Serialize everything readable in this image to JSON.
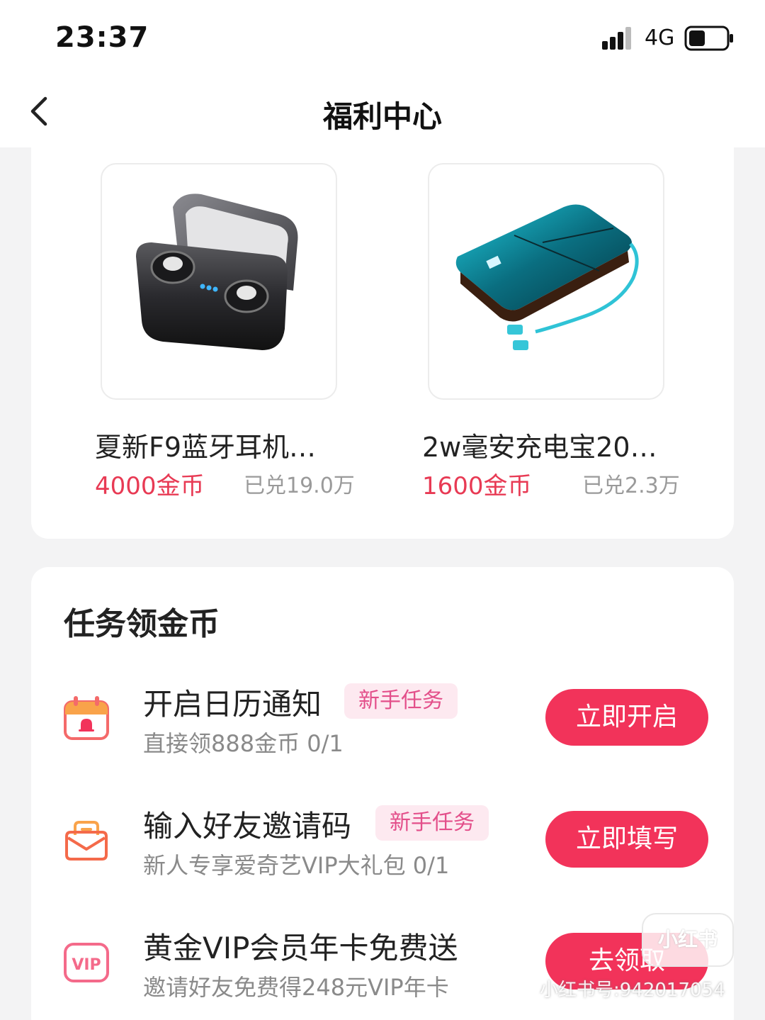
{
  "status_bar": {
    "time": "23:37",
    "network": "4G",
    "signal_icon": "cellular-signal-icon",
    "battery_icon": "battery-icon"
  },
  "nav": {
    "back_icon": "chevron-left-icon",
    "title": "福利中心"
  },
  "products": [
    {
      "name": "夏新F9蓝牙耳机…",
      "price": "4000金币",
      "sold": "已兑19.0万",
      "image": "wireless-earbuds-image"
    },
    {
      "name": "2w毫安充电宝20…",
      "price": "1600金币",
      "sold": "已兑2.3万",
      "image": "power-bank-image"
    }
  ],
  "tasks": {
    "title": "任务领金币",
    "items": [
      {
        "title": "开启日历通知",
        "tag": "新手任务",
        "desc": "直接领888金币 0/1",
        "button": "立即开启",
        "icon": "calendar-bell-icon"
      },
      {
        "title": "输入好友邀请码",
        "tag": "新手任务",
        "desc": "新人专享爱奇艺VIP大礼包 0/1",
        "button": "立即填写",
        "icon": "envelope-icon"
      },
      {
        "title": "黄金VIP会员年卡免费送",
        "tag": "",
        "desc": "邀请好友免费得248元VIP年卡",
        "button": "去领取",
        "icon": "vip-badge-icon"
      }
    ]
  },
  "watermark": {
    "logo": "小红书",
    "text": "小红书号:942017054"
  },
  "colors": {
    "accent": "#f2335a",
    "price": "#e83a54",
    "tag_text": "#e34f8a",
    "tag_bg": "#fde9f0"
  }
}
